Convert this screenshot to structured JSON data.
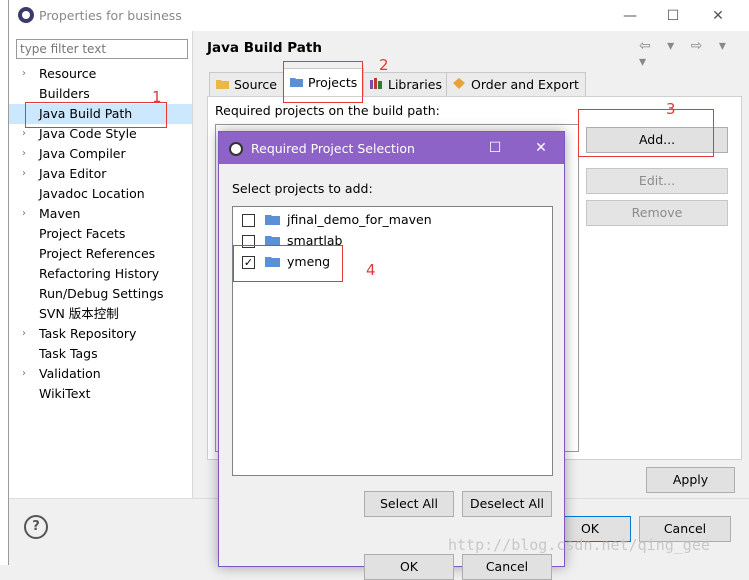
{
  "window": {
    "title": "Properties for business",
    "minimize": "—",
    "maximize": "☐",
    "close": "✕"
  },
  "filter": {
    "placeholder": "type filter text"
  },
  "tree": [
    {
      "label": "Resource",
      "expandable": true
    },
    {
      "label": "Builders",
      "expandable": false
    },
    {
      "label": "Java Build Path",
      "expandable": false,
      "selected": true
    },
    {
      "label": "Java Code Style",
      "expandable": true
    },
    {
      "label": "Java Compiler",
      "expandable": true
    },
    {
      "label": "Java Editor",
      "expandable": true
    },
    {
      "label": "Javadoc Location",
      "expandable": false
    },
    {
      "label": "Maven",
      "expandable": true
    },
    {
      "label": "Project Facets",
      "expandable": false
    },
    {
      "label": "Project References",
      "expandable": false
    },
    {
      "label": "Refactoring History",
      "expandable": false
    },
    {
      "label": "Run/Debug Settings",
      "expandable": false
    },
    {
      "label": "SVN 版本控制",
      "expandable": false
    },
    {
      "label": "Task Repository",
      "expandable": true
    },
    {
      "label": "Task Tags",
      "expandable": false
    },
    {
      "label": "Validation",
      "expandable": true
    },
    {
      "label": "WikiText",
      "expandable": false
    }
  ],
  "page": {
    "title": "Java Build Path",
    "history": "⇦ ▾ ⇨ ▾ ▾",
    "tabs": {
      "source": "Source",
      "projects": "Projects",
      "libraries": "Libraries",
      "order": "Order and Export"
    },
    "required_label": "Required projects on the build path:",
    "add": "Add...",
    "edit": "Edit...",
    "remove": "Remove",
    "apply": "Apply"
  },
  "bottom": {
    "help": "?",
    "ok": "OK",
    "cancel": "Cancel"
  },
  "dialog": {
    "title": "Required Project Selection",
    "maximize": "☐",
    "close": "✕",
    "label": "Select projects to add:",
    "projects": [
      {
        "name": "jfinal_demo_for_maven",
        "checked": false
      },
      {
        "name": "smartlab",
        "checked": false
      },
      {
        "name": "ymeng",
        "checked": true
      }
    ],
    "select_all": "Select All",
    "deselect_all": "Deselect All",
    "ok": "OK",
    "cancel": "Cancel"
  },
  "annotations": {
    "n1": "1",
    "n2": "2",
    "n3": "3",
    "n4": "4"
  },
  "watermark": "http://blog.csdn.net/qing_gee",
  "colors": {
    "dialog_title": "#8e63c7",
    "annotation": "#e53935",
    "selection": "#cce8ff"
  }
}
